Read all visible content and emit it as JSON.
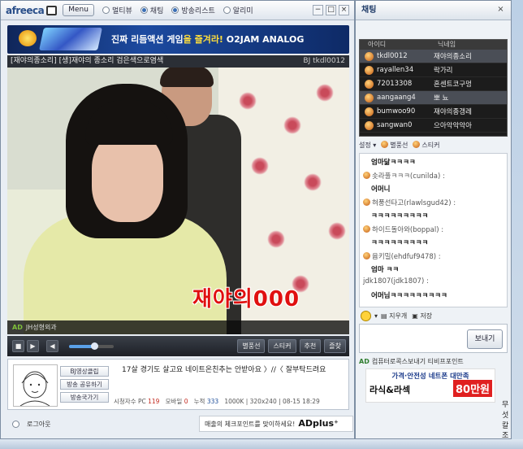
{
  "player": {
    "logo": "afreeca",
    "menu": "Menu",
    "nav": [
      {
        "label": "멀티뷰",
        "active": false
      },
      {
        "label": "채팅",
        "active": true
      },
      {
        "label": "방송리스트",
        "active": true
      },
      {
        "label": "알리미",
        "active": false
      }
    ],
    "window_controls": [
      "−",
      "□",
      "×"
    ],
    "banner": {
      "prefix": "진짜 리듬액션 게임",
      "highlight": "을 즐겨라!",
      "suffix": " O2JAM ANALOG"
    },
    "stream_title": "[재야의종소리] [생]재야의 종소리 검은색으로염색",
    "bj_label": "BJ",
    "bj_id": "tkdl0012",
    "video_caption": "재야의000",
    "video_strip_badge": "AD",
    "video_strip_text": "JH성형외과",
    "controls": {
      "stop": "■",
      "play": "▶",
      "volume_icon": "◀",
      "star_balloon": "별풍선",
      "sticker": "스티커",
      "recommend": "추천",
      "favorite": "즐찾"
    },
    "info": {
      "buttons": [
        "BJ영상클립",
        "방송 공유하기",
        "방송국가기"
      ],
      "title": "17살 경기도 살고요 네이트온친추는 안받아요 〉//〈 잘부탁드려요",
      "stats": {
        "viewers_label": "시청자수 PC",
        "viewers_pc": "119",
        "mobile_label": "모바일",
        "mobile": "0",
        "total_label": "누적",
        "total": "333",
        "quality": "1000K | 320x240 | 08-15 18:29"
      }
    },
    "logout": "로그아웃",
    "ad": {
      "text": "매출의 체크포인트를 맞이하세요!",
      "brand": "ADplus⁺"
    }
  },
  "chat": {
    "title": "채팅",
    "close": "×",
    "columns": {
      "id": "아이디",
      "nick": "닉네임"
    },
    "users": [
      {
        "id": "tkdl0012",
        "nick": "재야의종소리",
        "selected": true
      },
      {
        "id": "rayallen34",
        "nick": "락가리",
        "selected": false
      },
      {
        "id": "72013308",
        "nick": "혼센트코구멍",
        "selected": false
      },
      {
        "id": "aangaang4",
        "nick": "뽀 뇨",
        "selected": true
      },
      {
        "id": "bumwoo90",
        "nick": "재야의종갱레",
        "selected": false
      },
      {
        "id": "sangwan0",
        "nick": "으아악악악아",
        "selected": false
      }
    ],
    "toolbar": {
      "settings": "설정",
      "star_balloon": "별풍선",
      "sticker": "스티커"
    },
    "messages": [
      {
        "kind": "text",
        "text": "엄마닮ㅋㅋㅋㅋ"
      },
      {
        "kind": "name",
        "text": "솟라풀ㅋㅋㅋ(cunilda) :"
      },
      {
        "kind": "text",
        "text": "어머니"
      },
      {
        "kind": "name",
        "text": "혀풍선타고(rlawlsgud42) :"
      },
      {
        "kind": "text",
        "text": "ㅋㅋㅋㅋㅋㅋㅋㅋㅋ"
      },
      {
        "kind": "name",
        "text": "하이드돌아와(boppal) :"
      },
      {
        "kind": "text",
        "text": "ㅋㅋㅋㅋㅋㅋㅋㅋㅋ"
      },
      {
        "kind": "name",
        "text": "윰키밀(ehdfuf9478) :"
      },
      {
        "kind": "text",
        "text": "엄마 ㅋㅋ"
      },
      {
        "kind": "name",
        "text": "jdk1807(jdk1807) :"
      },
      {
        "kind": "text",
        "text": "어머님ㅋㅋㅋㅋㅋㅋㅋㅋㅋ"
      }
    ],
    "input_tools": {
      "clear": "지우개",
      "save": "저장"
    },
    "send": "보내기",
    "ad_line": {
      "badge": "AD",
      "text": "컴퓨터로콕스보내기 티비프포인트"
    },
    "promo": {
      "line1": "가격·안전성 네트폰 대만족",
      "line2": "라식&라섹",
      "price": "80만원"
    }
  },
  "desktop": {
    "right_texts": [
      "무",
      "섯",
      "칼",
      "조"
    ]
  }
}
